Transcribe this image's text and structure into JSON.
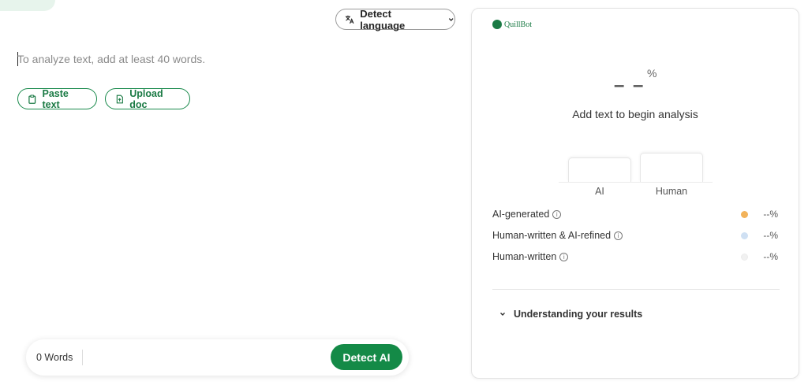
{
  "editor": {
    "language_label": "Detect language",
    "placeholder": "To analyze text, add at least 40 words.",
    "paste_label": "Paste text",
    "upload_label": "Upload doc",
    "word_count": "0 Words",
    "detect_label": "Detect AI"
  },
  "results": {
    "logo_text": "QuillBot",
    "score": "– –",
    "score_unit": "%",
    "message": "Add text to begin analysis",
    "bars": [
      {
        "label": "AI"
      },
      {
        "label": "Human"
      }
    ],
    "legend": [
      {
        "label": "AI-generated",
        "value": "--%",
        "color": "#f2b35b"
      },
      {
        "label": "Human-written & AI-refined",
        "value": "--%",
        "color": "#cfe0f3"
      },
      {
        "label": "Human-written",
        "value": "--%",
        "color": "#f1f1f1"
      }
    ],
    "understanding_label": "Understanding your results"
  },
  "colors": {
    "brand_green": "#148a47"
  }
}
